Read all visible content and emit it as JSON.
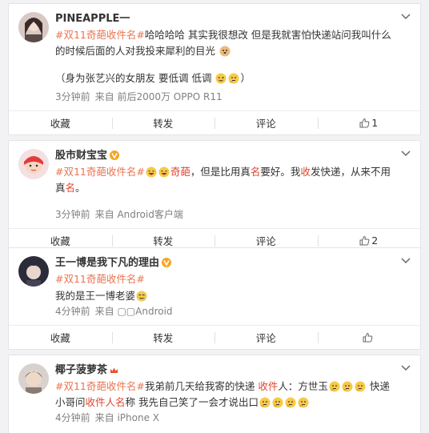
{
  "posts": [
    {
      "username": "PINEAPPLE一",
      "tag": "#双11奇葩收件名#",
      "text_a": "哈哈哈哈 其实我很想改 但是我就害怕快递站问我叫什么的时候后面的人对我投来犀利的目光",
      "text_b": "（身为张艺兴的女朋友 要低调 低调",
      "text_b_end": "）",
      "time": "3分钟前",
      "source": "来自 前后2000万 OPPO R11",
      "collect": "收藏",
      "forward": "转发",
      "comment": "评论",
      "likes": "1"
    },
    {
      "username": "股市财宝宝",
      "tag": "#双11奇葩收件名#",
      "text_a": "奇葩",
      "text_b": "，但是比用真",
      "text_c": "名",
      "text_d": "要好。我",
      "text_e": "收",
      "text_f": "发快递，从来不用真",
      "text_g": "名",
      "text_h": "。",
      "time": "3分钟前",
      "source": "来自 Android客户端",
      "collect": "收藏",
      "forward": "转发",
      "comment": "评论",
      "likes": "2"
    },
    {
      "username": "王一博是我下凡的理由",
      "tag": "#双11奇葩收件名#",
      "text_a": "我的是王一博老婆",
      "time": "4分钟前",
      "source": "来自 ▢▢Android",
      "collect": "收藏",
      "forward": "转发",
      "comment": "评论",
      "likes": ""
    },
    {
      "username": "椰子菠萝茶",
      "tag": "#双11奇葩收件名#",
      "text_a": "我弟前几天给我寄的快递 ",
      "text_b": "收件",
      "text_c": "人：方世玉",
      "text_d": " 快递小哥问",
      "text_e": "收件人名",
      "text_f": "称 我先自己笑了一会才说出口",
      "time": "4分钟前",
      "source": "来自 iPhone X"
    }
  ],
  "colors": {
    "tag": "#eb7350",
    "keyword": "#e0452e",
    "meta": "#808080"
  },
  "icons": [
    "chevron-down-icon",
    "thumbs-up-icon",
    "v-badge-icon",
    "crown-badge-icon"
  ]
}
